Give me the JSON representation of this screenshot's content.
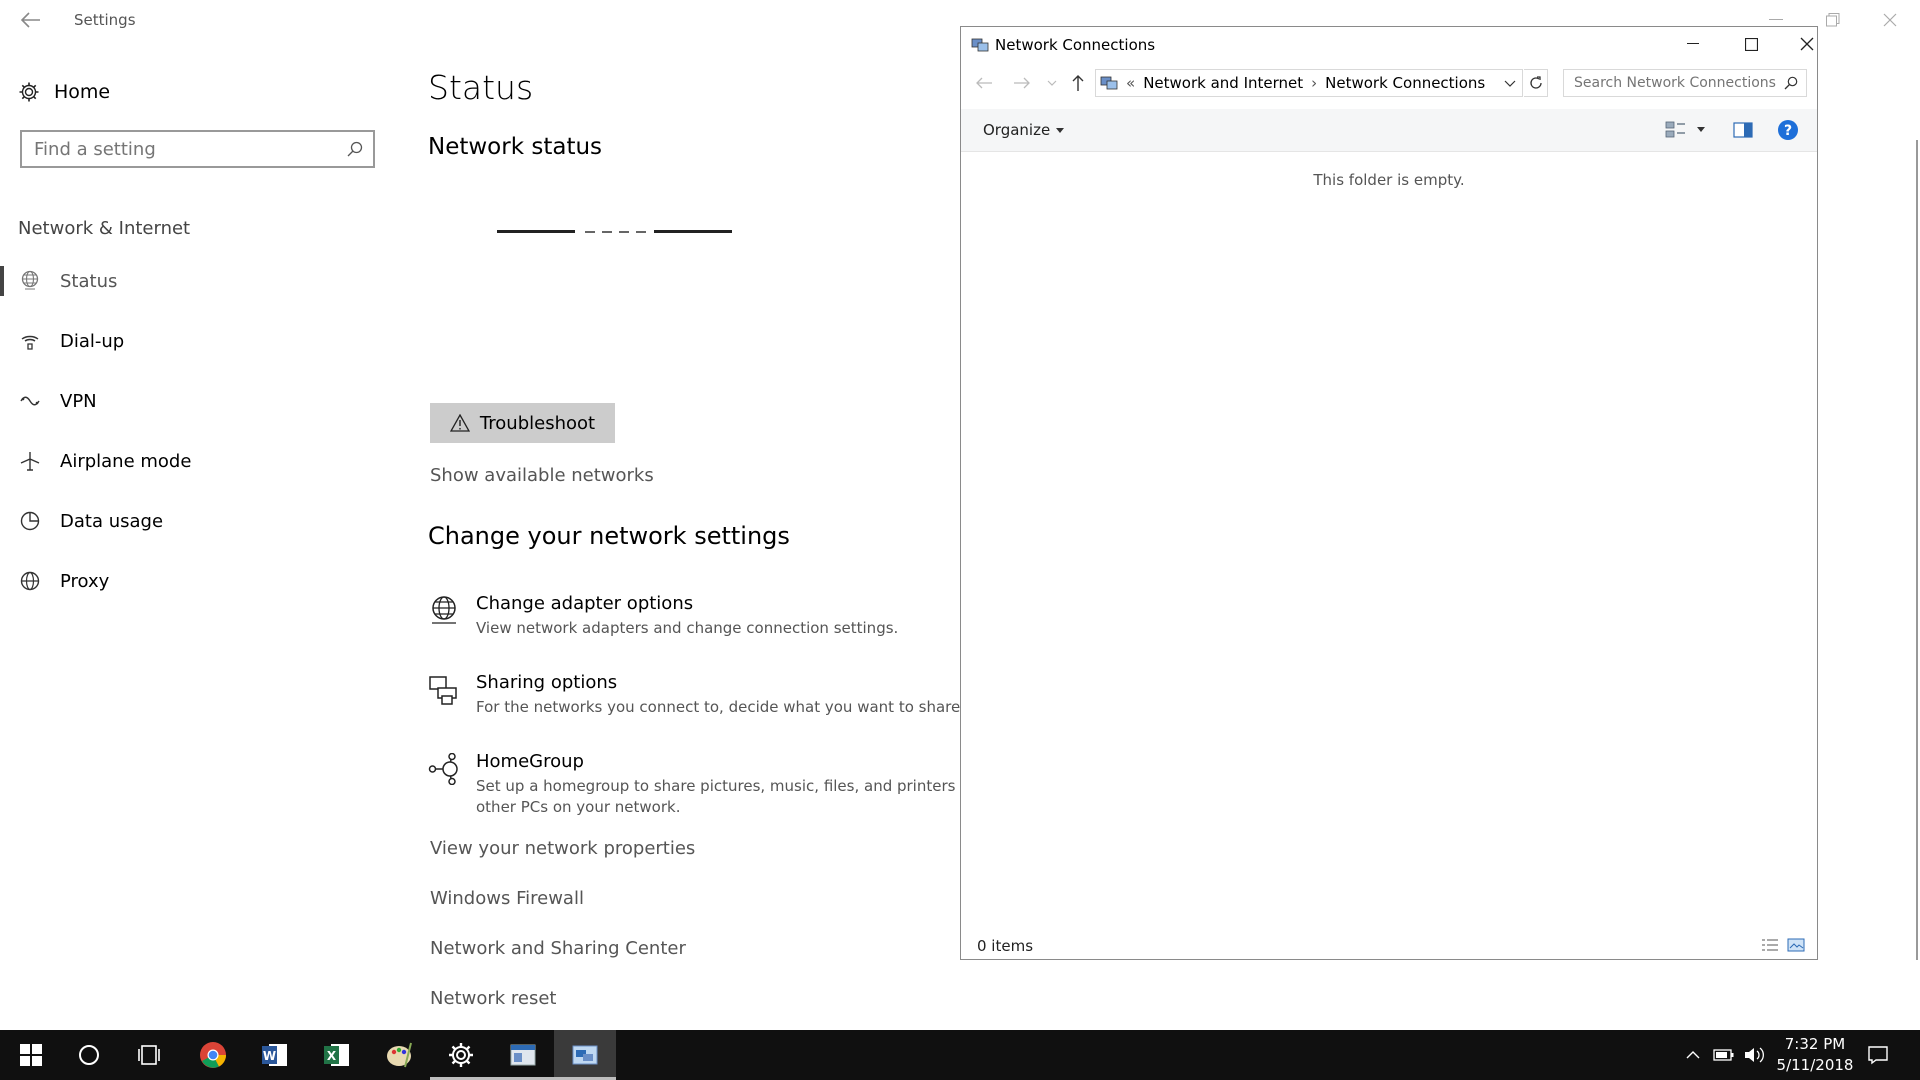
{
  "settings": {
    "title": "Settings",
    "home_label": "Home",
    "search_placeholder": "Find a setting",
    "section_label": "Network & Internet",
    "nav_items": [
      {
        "label": "Status"
      },
      {
        "label": "Dial-up"
      },
      {
        "label": "VPN"
      },
      {
        "label": "Airplane mode"
      },
      {
        "label": "Data usage"
      },
      {
        "label": "Proxy"
      }
    ],
    "page_title": "Status",
    "network_status": "Network status",
    "troubleshoot": "Troubleshoot",
    "show_networks": "Show available networks",
    "change_title": "Change your network settings",
    "options": [
      {
        "title": "Change adapter options",
        "desc": "View network adapters and change connection settings."
      },
      {
        "title": "Sharing options",
        "desc": "For the networks you connect to, decide what you want to share."
      },
      {
        "title": "HomeGroup",
        "desc": "Set up a homegroup to share pictures, music, files, and printers with other PCs on your network."
      }
    ],
    "links": {
      "properties": "View your network properties",
      "firewall": "Windows Firewall",
      "sharing_center": "Network and Sharing Center",
      "reset": "Network reset"
    }
  },
  "explorer": {
    "title": "Network Connections",
    "breadcrumb": [
      "Network and Internet",
      "Network Connections"
    ],
    "breadcrumb_prefix": "«",
    "search_placeholder": "Search Network Connections",
    "organize": "Organize",
    "empty_message": "This folder is empty.",
    "status": "0 items"
  },
  "taskbar": {
    "time": "7:32 PM",
    "date": "5/11/2018"
  },
  "colors": {
    "taskbar_bg": "#101010",
    "help_blue": "#1e6fd9"
  }
}
